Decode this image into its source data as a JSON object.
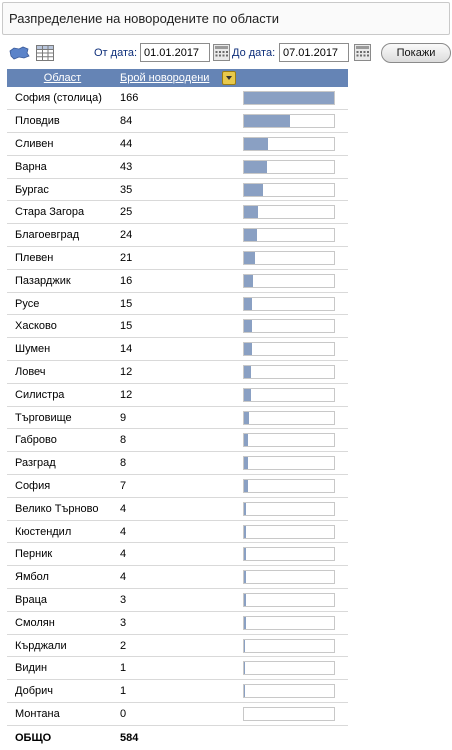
{
  "page": {
    "title": "Разпределение на новородените по области"
  },
  "filters": {
    "from_label": "От дата:",
    "from_value": "01.01.2017",
    "to_label": "До дата:",
    "to_value": "07.01.2017",
    "show_button": "Покажи"
  },
  "view_icons": {
    "map": "map-icon",
    "table": "table-icon"
  },
  "grid": {
    "headers": {
      "region": "Област",
      "count": "Брой новородени"
    },
    "max_value": 166,
    "rows": [
      {
        "region": "София (столица)",
        "count": "166",
        "value": 166
      },
      {
        "region": "Пловдив",
        "count": "84",
        "value": 84
      },
      {
        "region": "Сливен",
        "count": "44",
        "value": 44
      },
      {
        "region": "Варна",
        "count": "43",
        "value": 43
      },
      {
        "region": "Бургас",
        "count": "35",
        "value": 35
      },
      {
        "region": "Стара Загора",
        "count": "25",
        "value": 25
      },
      {
        "region": "Благоевград",
        "count": "24",
        "value": 24
      },
      {
        "region": "Плевен",
        "count": "21",
        "value": 21
      },
      {
        "region": "Пазарджик",
        "count": "16",
        "value": 16
      },
      {
        "region": "Русе",
        "count": "15",
        "value": 15
      },
      {
        "region": "Хасково",
        "count": "15",
        "value": 15
      },
      {
        "region": "Шумен",
        "count": "14",
        "value": 14
      },
      {
        "region": "Ловеч",
        "count": "12",
        "value": 12
      },
      {
        "region": "Силистра",
        "count": "12",
        "value": 12
      },
      {
        "region": "Търговище",
        "count": "9",
        "value": 9
      },
      {
        "region": "Габрово",
        "count": "8",
        "value": 8
      },
      {
        "region": "Разград",
        "count": "8",
        "value": 8
      },
      {
        "region": "София",
        "count": "7",
        "value": 7
      },
      {
        "region": "Велико Търново",
        "count": "4",
        "value": 4
      },
      {
        "region": "Кюстендил",
        "count": "4",
        "value": 4
      },
      {
        "region": "Перник",
        "count": "4",
        "value": 4
      },
      {
        "region": "Ямбол",
        "count": "4",
        "value": 4
      },
      {
        "region": "Враца",
        "count": "3",
        "value": 3
      },
      {
        "region": "Смолян",
        "count": "3",
        "value": 3
      },
      {
        "region": "Кърджали",
        "count": "2",
        "value": 2
      },
      {
        "region": "Видин",
        "count": "1",
        "value": 1
      },
      {
        "region": "Добрич",
        "count": "1",
        "value": 1
      },
      {
        "region": "Монтана",
        "count": "0",
        "value": 0
      }
    ],
    "total": {
      "label": "ОБЩО",
      "count": "584"
    }
  },
  "colors": {
    "header_bg": "#6584b5",
    "bar_fill": "#8aa0c3",
    "label_text": "#0d2e7a"
  }
}
